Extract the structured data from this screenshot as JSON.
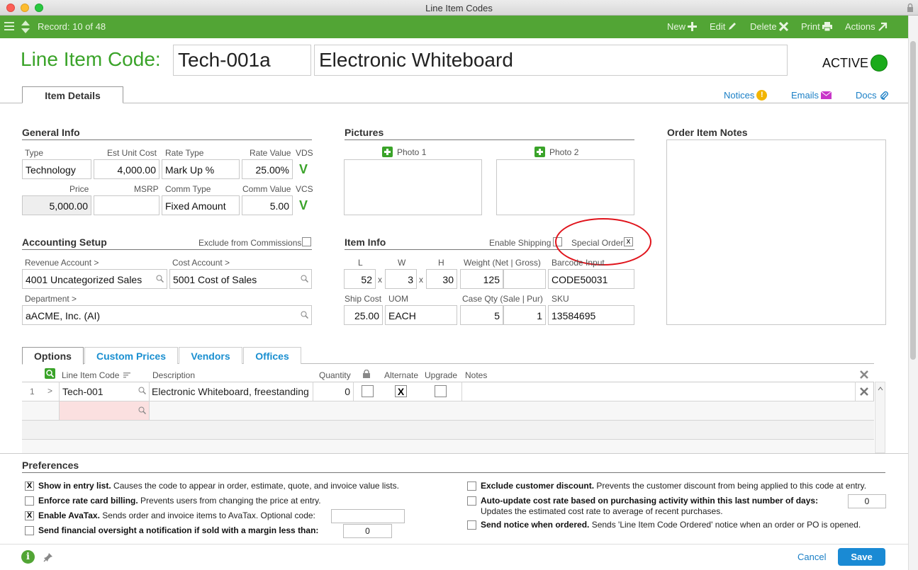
{
  "window": {
    "title": "Line Item Codes"
  },
  "toolbar": {
    "record": "Record: 10 of 48",
    "new": "New",
    "edit": "Edit",
    "delete": "Delete",
    "print": "Print",
    "actions": "Actions"
  },
  "header": {
    "label": "Line Item Code:",
    "code": "Tech-001a",
    "description": "Electronic Whiteboard",
    "status": "ACTIVE",
    "status_color": "#1bab1b"
  },
  "tabs": {
    "item_details": "Item Details"
  },
  "links": {
    "notices": "Notices",
    "emails": "Emails",
    "docs": "Docs"
  },
  "general": {
    "title": "General Info",
    "type_label": "Type",
    "type": "Technology",
    "est_unit_cost_label": "Est Unit Cost",
    "est_unit_cost": "4,000.00",
    "rate_type_label": "Rate Type",
    "rate_type": "Mark Up %",
    "rate_value_label": "Rate Value",
    "rate_value": "25.00%",
    "vds_label": "VDS",
    "vds": "V",
    "price_label": "Price",
    "price": "5,000.00",
    "msrp_label": "MSRP",
    "msrp": "",
    "comm_type_label": "Comm Type",
    "comm_type": "Fixed Amount",
    "comm_value_label": "Comm Value",
    "comm_value": "5.00",
    "vcs_label": "VCS",
    "vcs": "V"
  },
  "pictures": {
    "title": "Pictures",
    "photo1": "Photo 1",
    "photo2": "Photo 2"
  },
  "notes": {
    "title": "Order Item Notes"
  },
  "accounting": {
    "title": "Accounting Setup",
    "exclude_label": "Exclude from Commissions",
    "revenue_label": "Revenue Account >",
    "revenue": "4001 Uncategorized Sales",
    "cost_label": "Cost Account >",
    "cost": "5001 Cost of Sales",
    "dept_label": "Department >",
    "dept": "aACME, Inc. (AI)"
  },
  "iteminfo": {
    "title": "Item Info",
    "enable_shipping_label": "Enable Shipping",
    "special_order_label": "Special Order",
    "special_order_mark": "x",
    "l_label": "L",
    "l": "52",
    "w_label": "W",
    "w": "3",
    "h_label": "H",
    "h": "30",
    "x_sep": "x",
    "weight_label": "Weight (Net | Gross)",
    "weight_net": "125",
    "weight_gross": "",
    "barcode_label": "Barcode Input",
    "barcode": "CODE50031",
    "ship_cost_label": "Ship Cost",
    "ship_cost": "25.00",
    "uom_label": "UOM",
    "uom": "EACH",
    "case_qty_label": "Case Qty (Sale | Pur)",
    "case_sale": "5",
    "case_pur": "1",
    "sku_label": "SKU",
    "sku": "13584695"
  },
  "lower_tabs": {
    "options": "Options",
    "custom_prices": "Custom Prices",
    "vendors": "Vendors",
    "offices": "Offices"
  },
  "grid": {
    "col_code": "Line Item Code",
    "col_desc": "Description",
    "col_qty": "Quantity",
    "col_alt": "Alternate",
    "col_upgrade": "Upgrade",
    "col_notes": "Notes",
    "row1": {
      "num": "1",
      "arrow": ">",
      "code": "Tech-001",
      "desc": "Electronic Whiteboard, freestanding",
      "qty": "0",
      "alt_mark": "X"
    }
  },
  "preferences": {
    "title": "Preferences",
    "show_bold": "Show in entry list.",
    "show_text": " Causes the code to appear in order, estimate, quote, and invoice value lists.",
    "show_mark": "X",
    "enforce_bold": "Enforce rate card billing.",
    "enforce_text": " Prevents users from changing the price at entry.",
    "avatax_bold": "Enable AvaTax.",
    "avatax_text": " Sends order and invoice items to AvaTax. Optional code:",
    "avatax_mark": "X",
    "avatax_code": "",
    "oversight_bold": "Send financial oversight a notification if sold with a margin less than:",
    "oversight_value": "0",
    "exclude_bold": "Exclude customer discount.",
    "exclude_text": " Prevents the customer discount from being applied to this code at entry.",
    "autoupdate_bold": "Auto-update cost rate based on purchasing activity within this last number of days:",
    "autoupdate_text": "Updates the estimated cost rate to average of recent purchases.",
    "autoupdate_value": "0",
    "notice_bold": "Send notice when ordered.",
    "notice_text": " Sends 'Line Item Code Ordered' notice when an order or PO is opened."
  },
  "footer": {
    "cancel": "Cancel",
    "save": "Save"
  }
}
